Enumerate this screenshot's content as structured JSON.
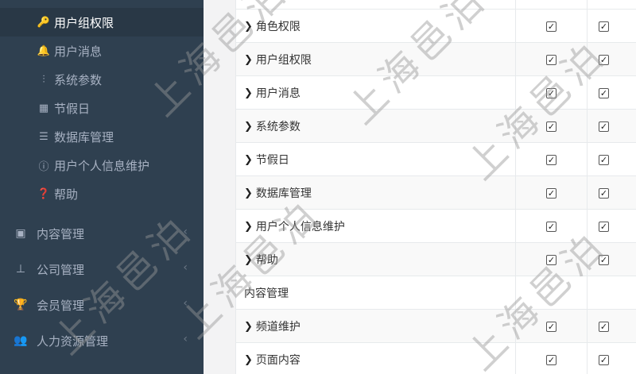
{
  "sidebar": {
    "subitems": [
      {
        "label": "用户组权限",
        "icon": "key-icon",
        "glyph": "🔑"
      },
      {
        "label": "用户消息",
        "icon": "bell-icon",
        "glyph": "🔔"
      },
      {
        "label": "系统参数",
        "icon": "sliders-icon",
        "glyph": "⫶"
      },
      {
        "label": "节假日",
        "icon": "calendar-icon",
        "glyph": "▦"
      },
      {
        "label": "数据库管理",
        "icon": "database-icon",
        "glyph": "☰"
      },
      {
        "label": "用户个人信息维护",
        "icon": "info-icon",
        "glyph": "ⓘ"
      },
      {
        "label": "帮助",
        "icon": "question-icon",
        "glyph": "❓"
      }
    ],
    "modules": [
      {
        "label": "内容管理",
        "icon": "content-icon",
        "glyph": "▣"
      },
      {
        "label": "公司管理",
        "icon": "sitemap-icon",
        "glyph": "⊥"
      },
      {
        "label": "会员管理",
        "icon": "trophy-icon",
        "glyph": "🏆"
      },
      {
        "label": "人力资源管理",
        "icon": "users-icon",
        "glyph": "👥"
      }
    ]
  },
  "table": {
    "rows": [
      {
        "label": "角色权限",
        "type": "item"
      },
      {
        "label": "用户组权限",
        "type": "item"
      },
      {
        "label": "用户消息",
        "type": "item"
      },
      {
        "label": "系统参数",
        "type": "item"
      },
      {
        "label": "节假日",
        "type": "item"
      },
      {
        "label": "数据库管理",
        "type": "item"
      },
      {
        "label": "用户个人信息维护",
        "type": "item"
      },
      {
        "label": "帮助",
        "type": "item"
      },
      {
        "label": "内容管理",
        "type": "group"
      },
      {
        "label": "频道维护",
        "type": "item"
      },
      {
        "label": "页面内容",
        "type": "item"
      }
    ],
    "check_glyph": "✓"
  },
  "watermark": {
    "text": "上海邑泊"
  },
  "colors": {
    "sidebar_bg": "#2f4050",
    "sidebar_active": "#293846",
    "sidebar_text": "#a7b1c2"
  }
}
